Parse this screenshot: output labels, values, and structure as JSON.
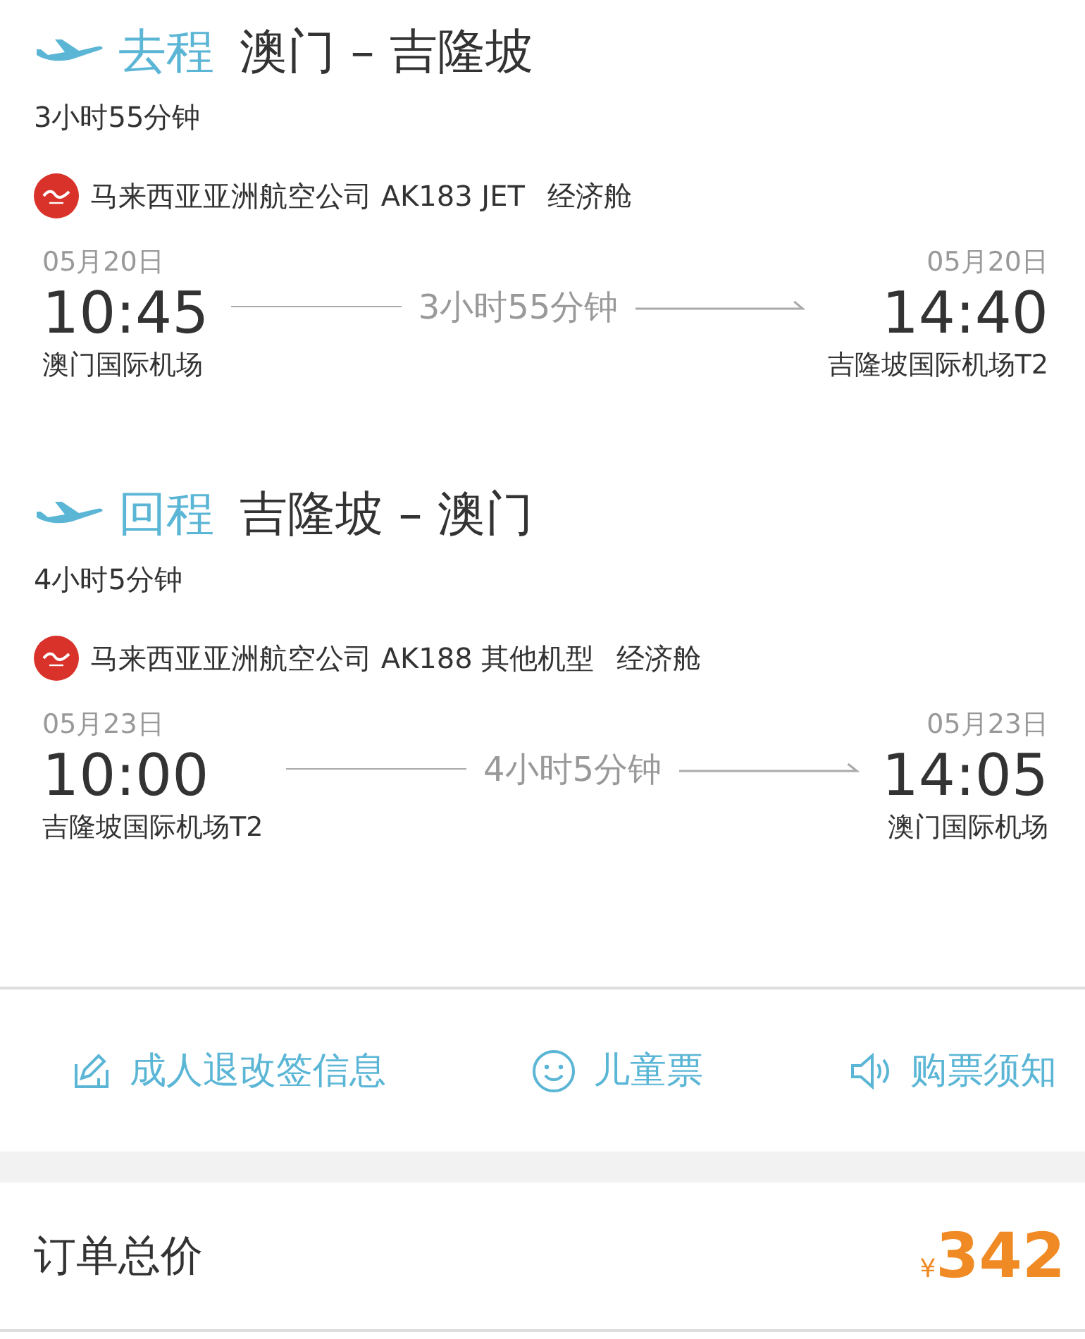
{
  "legs": [
    {
      "direction": "去程",
      "route": "澳门 – 吉隆坡",
      "duration": "3小时55分钟",
      "airline": "马来西亚亚洲航空公司 AK183 JET",
      "cabin": "经济舱",
      "depart": {
        "date": "05月20日",
        "time": "10:45",
        "airport": "澳门国际机场"
      },
      "flight_time": "3小时55分钟",
      "arrive": {
        "date": "05月20日",
        "time": "14:40",
        "airport": "吉隆坡国际机场T2"
      }
    },
    {
      "direction": "回程",
      "route": "吉隆坡 – 澳门",
      "duration": "4小时5分钟",
      "airline": "马来西亚亚洲航空公司 AK188 其他机型",
      "cabin": "经济舱",
      "depart": {
        "date": "05月23日",
        "time": "10:00",
        "airport": "吉隆坡国际机场T2"
      },
      "flight_time": "4小时5分钟",
      "arrive": {
        "date": "05月23日",
        "time": "14:05",
        "airport": "澳门国际机场"
      }
    }
  ],
  "actions": [
    {
      "kind": "edit",
      "label": "成人退改签信息"
    },
    {
      "kind": "smile",
      "label": "儿童票"
    },
    {
      "kind": "speaker",
      "label": "购票须知"
    }
  ],
  "total": {
    "label": "订单总价",
    "currency": "¥",
    "amount": "342"
  }
}
